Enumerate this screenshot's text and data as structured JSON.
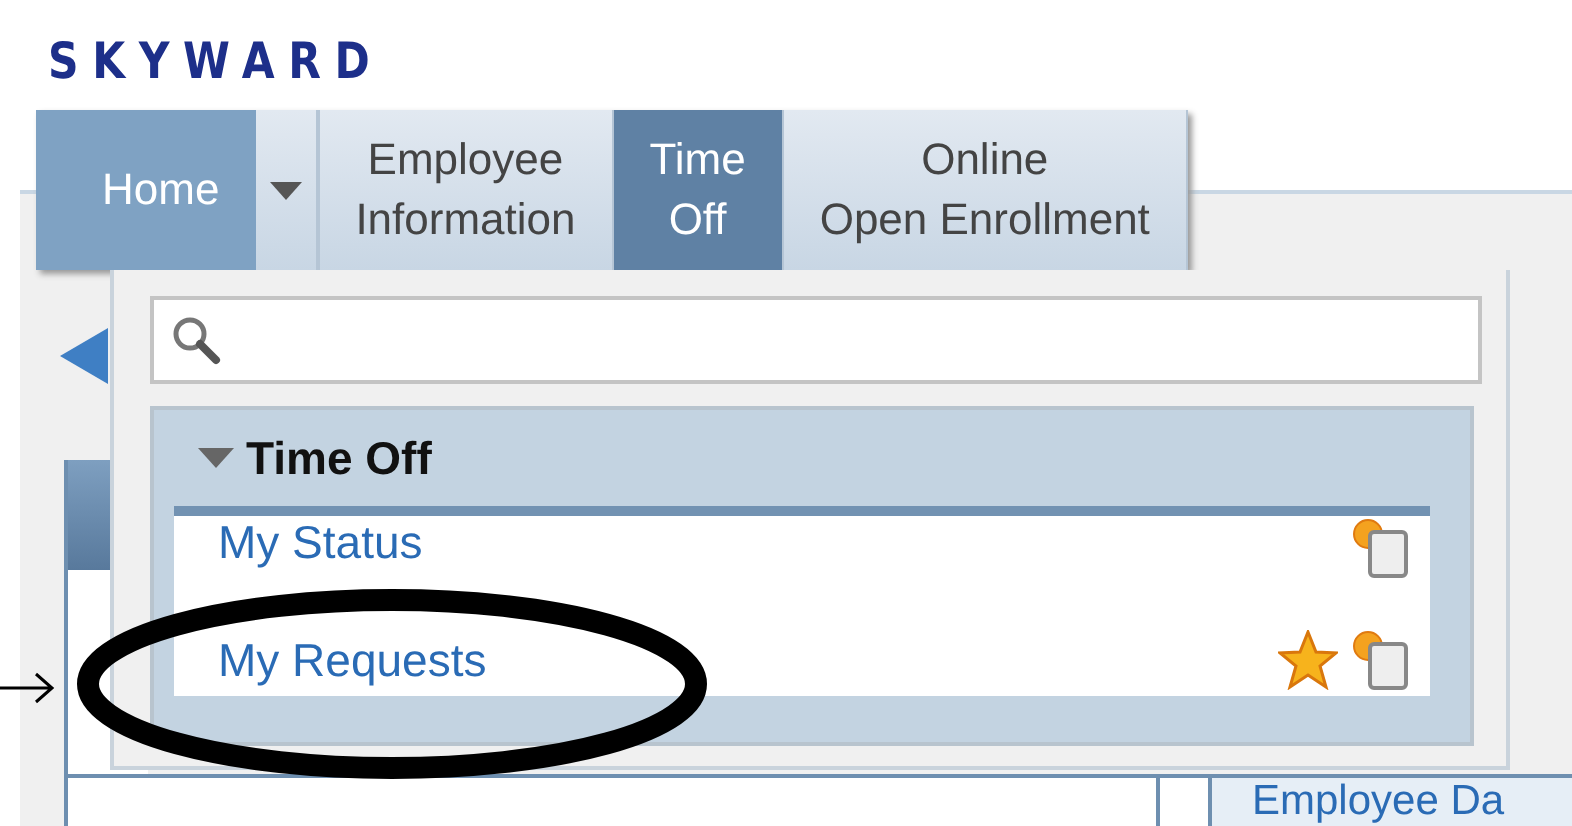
{
  "logo": "SKYWARD",
  "nav": {
    "tabs": [
      {
        "label": "Home",
        "kind": "home",
        "selected": false
      },
      {
        "label": "Employee\nInformation",
        "kind": "tab",
        "selected": false
      },
      {
        "label": "Time\nOff",
        "kind": "tab",
        "selected": true
      },
      {
        "label": "Online\nOpen Enrollment",
        "kind": "tab",
        "selected": false
      }
    ]
  },
  "menu": {
    "section": {
      "title": "Time Off",
      "expanded": true,
      "items": [
        {
          "label": "My Status",
          "favorite": false
        },
        {
          "label": "My Requests",
          "favorite": true
        }
      ]
    }
  },
  "background_link": "Employee Da",
  "annotations": [
    {
      "kind": "ellipse"
    },
    {
      "kind": "arrow"
    }
  ]
}
